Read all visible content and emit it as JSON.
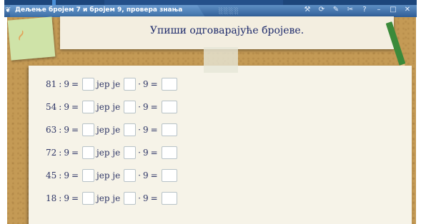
{
  "window": {
    "title": "Дељење бројем 7 и бројем 9, провера знања",
    "title_icon": "leaf-icon",
    "decoration": "░░░░",
    "toolbar_icons": [
      "tools-icon",
      "refresh-icon",
      "pencil-icon",
      "scissors-icon",
      "help-icon",
      "minimize-icon",
      "maximize-icon",
      "close-icon"
    ],
    "toolbar_glyphs": [
      "⚒",
      "⟳",
      "✎",
      "✂",
      "?",
      "–",
      "□",
      "✕"
    ]
  },
  "header": {
    "instruction": "Упиши одговарајуће бројеве."
  },
  "exercise": {
    "word_jer_je": "јер је",
    "dot": "·",
    "colon": ":",
    "equals": "=",
    "divisor": "9",
    "rows": [
      {
        "dividend": "81"
      },
      {
        "dividend": "54"
      },
      {
        "dividend": "63"
      },
      {
        "dividend": "72"
      },
      {
        "dividend": "45"
      },
      {
        "dividend": "18"
      }
    ]
  },
  "colors": {
    "titlebar": "#3d6fa6",
    "cork": "#c49a55",
    "sheet": "#f6f3e8",
    "text": "#2d3566"
  }
}
